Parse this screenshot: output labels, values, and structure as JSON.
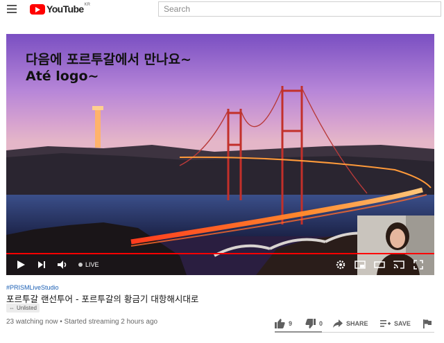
{
  "header": {
    "logo_text": "YouTube",
    "logo_region": "KR",
    "search_placeholder": "Search"
  },
  "player": {
    "caption_line1": "다음에 포르투갈에서 만나요~",
    "caption_line2": "Até logo~",
    "live_label": "LIVE",
    "progress_fraction": 1.0
  },
  "video": {
    "hashtag": "#PRISMLiveStudio",
    "title": "포르투갈 랜선투어 - 포르투갈의 황금기 대항해시대로",
    "visibility": "Unlisted",
    "meta": "23 watching now • Started streaming 2 hours ago"
  },
  "actions": {
    "likes": "9",
    "dislikes": "0",
    "share": "SHARE",
    "save": "SAVE"
  },
  "icons": [
    "menu-icon",
    "youtube-logo-icon",
    "play-icon",
    "next-icon",
    "volume-icon",
    "settings-icon",
    "miniplayer-icon",
    "theater-icon",
    "cast-icon",
    "fullscreen-icon",
    "link-icon",
    "thumbs-up-icon",
    "thumbs-down-icon",
    "share-icon",
    "save-playlist-icon",
    "flag-icon"
  ],
  "colors": {
    "brand_red": "#ff0000",
    "link_blue": "#1a5fb4"
  }
}
